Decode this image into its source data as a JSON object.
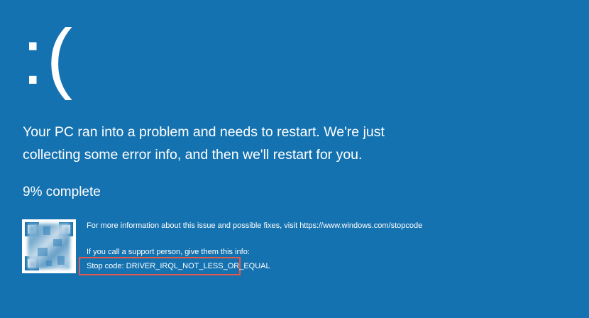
{
  "screen": {
    "background_color": "#1572B0",
    "sad_face": ":(",
    "message_line1": "Your PC ran into a problem and needs to restart. We're just",
    "message_line2": "collecting some error info, and then we'll restart for you.",
    "progress_text": "9% complete",
    "progress_percent": 9
  },
  "details": {
    "more_info": "For more information about this issue and possible fixes, visit https://www.windows.com/stopcode",
    "support": "If you call a support person, give them this info:",
    "stop_code": "Stop code: DRIVER_IRQL_NOT_LESS_OR_EQUAL",
    "highlight_color": "#E2584A"
  },
  "qr_code": {
    "icon": "qr-code-icon",
    "blurred": true
  }
}
